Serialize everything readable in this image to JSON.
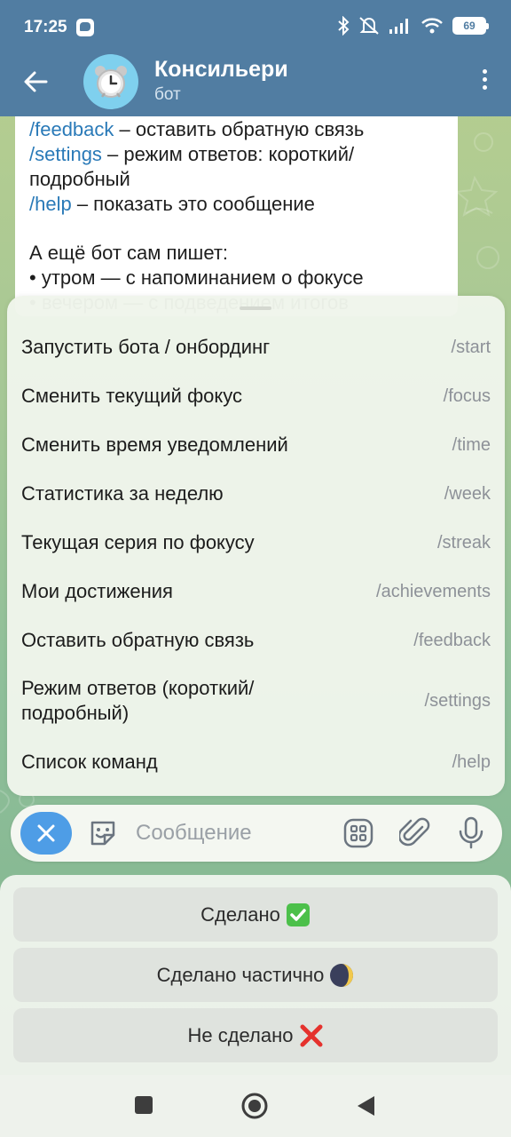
{
  "status_bar": {
    "time": "17:25",
    "battery": "69",
    "icons": [
      "messenger-icon",
      "bluetooth-icon",
      "mute-icon",
      "signal-icon",
      "wifi-icon",
      "battery-icon"
    ]
  },
  "header": {
    "title": "Консильери",
    "subtitle": "бот",
    "avatar_icon": "alarm-clock-icon"
  },
  "message": {
    "lines": [
      {
        "cmd": "/feedback",
        "text": " – оставить обратную связь"
      },
      {
        "cmd": "/settings",
        "text": " – режим ответов: короткий/"
      },
      {
        "cmd": "",
        "text": "подробный"
      },
      {
        "cmd": "/help",
        "text": " – показать это сообщение"
      }
    ],
    "para_title": "А ещё бот сам пишет:",
    "bullet_1": "• утром — с напоминанием о фокусе",
    "bullet_2": "• вечером — с подведением итогов"
  },
  "commands": [
    {
      "desc": "Запустить бота / онбординг",
      "code": "/start"
    },
    {
      "desc": "Сменить текущий фокус",
      "code": "/focus"
    },
    {
      "desc": "Сменить время уведомлений",
      "code": "/time"
    },
    {
      "desc": "Статистика за неделю",
      "code": "/week"
    },
    {
      "desc": "Текущая серия по фокусу",
      "code": "/streak"
    },
    {
      "desc": "Мои достижения",
      "code": "/achievements"
    },
    {
      "desc": "Оставить обратную связь",
      "code": "/feedback"
    },
    {
      "desc": "Режим ответов (короткий/\nподробный)",
      "code": "/settings"
    },
    {
      "desc": "Список команд",
      "code": "/help"
    }
  ],
  "input": {
    "placeholder": "Сообщение"
  },
  "reply_keyboard": [
    {
      "label": "Сделано",
      "emoji": "check-mark-icon"
    },
    {
      "label": "Сделано частично",
      "emoji": "moon-icon"
    },
    {
      "label": "Не сделано",
      "emoji": "cross-mark-icon"
    }
  ],
  "colors": {
    "header": "#517da2",
    "link": "#2a7ab8",
    "accent": "#4e9de6"
  }
}
